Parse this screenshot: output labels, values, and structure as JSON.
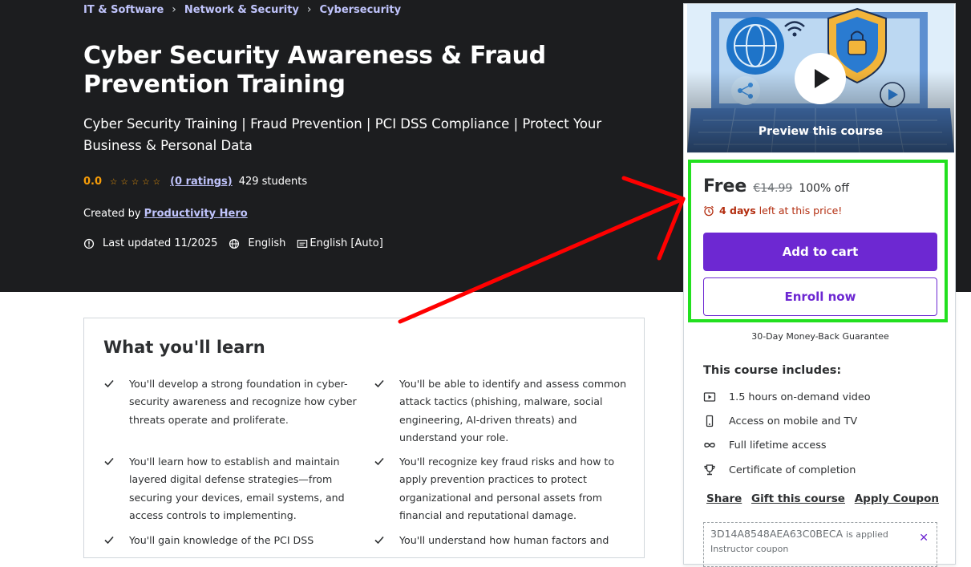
{
  "breadcrumbs": [
    "IT & Software",
    "Network & Security",
    "Cybersecurity"
  ],
  "course": {
    "title": "Cyber Security Awareness & Fraud Prevention Training",
    "subtitle": "Cyber Security Training | Fraud Prevention | PCI DSS Compliance | Protect Your Business & Personal Data",
    "rating": "0.0",
    "stars": "☆☆☆☆☆",
    "ratings_link": "(0 ratings)",
    "students": "429 students",
    "created_by_label": "Created by",
    "instructor": "Productivity Hero",
    "last_updated": "Last updated 11/2025",
    "language": "English",
    "captions": "English [Auto]"
  },
  "learn": {
    "heading": "What you'll learn",
    "items": [
      "You'll develop a strong foundation in cyber-security awareness and recognize how cyber threats operate and proliferate.",
      "You'll be able to identify and assess common attack tactics (phishing, malware, social engineering, AI-driven threats) and understand your role.",
      "You'll learn how to establish and maintain layered digital defense strategies—from securing your devices, email systems, and access controls to implementing.",
      "You'll recognize key fraud risks and how to apply prevention practices to protect organizational and personal assets from financial and reputational damage.",
      "You'll gain knowledge of the PCI DSS",
      "You'll understand how human factors and"
    ]
  },
  "sidebar": {
    "preview_label": "Preview this course",
    "price": "Free",
    "old_price": "€14.99",
    "discount": "100% off",
    "timer_bold": "4 days",
    "timer_rest": "left at this price!",
    "add_to_cart": "Add to cart",
    "enroll_now": "Enroll now",
    "guarantee": "30-Day Money-Back Guarantee",
    "includes_heading": "This course includes:",
    "includes": [
      {
        "icon": "video-icon",
        "text": "1.5 hours on-demand video"
      },
      {
        "icon": "mobile-icon",
        "text": "Access on mobile and TV"
      },
      {
        "icon": "infinity-icon",
        "text": "Full lifetime access"
      },
      {
        "icon": "trophy-icon",
        "text": "Certificate of completion"
      }
    ],
    "share": "Share",
    "gift": "Gift this course",
    "apply_coupon": "Apply Coupon",
    "coupon_code": "3D14A8548AEA63C0BECA",
    "coupon_applied": "is applied",
    "coupon_type": "Instructor coupon"
  },
  "colors": {
    "hero_bg": "#1c1d1f",
    "accent_purple": "#6d28d2",
    "link_lavender": "#c0c4fc",
    "star_orange": "#f69c08",
    "timer_red": "#b32d0f",
    "highlight_green": "#22e01f",
    "arrow_red": "#ff0000"
  }
}
